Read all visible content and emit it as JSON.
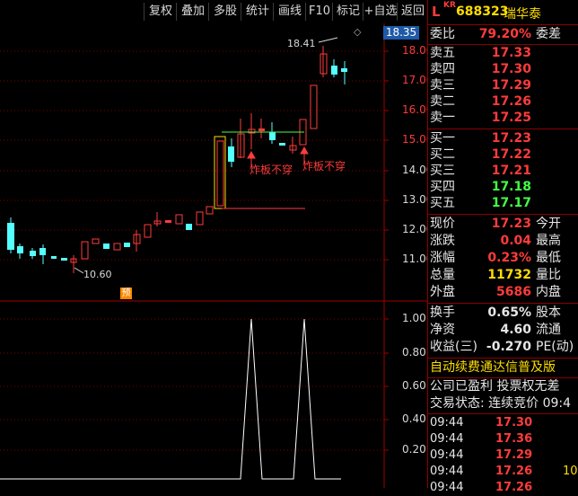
{
  "toolbar": {
    "buttons": [
      "复权",
      "叠加",
      "多股",
      "统计",
      "画线",
      "F10",
      "标记",
      "+自选",
      "返回"
    ]
  },
  "stock": {
    "market_tag": "L",
    "super_tag": "KR",
    "code": "688323",
    "name": "瑞华泰"
  },
  "chart": {
    "current_price_tag": "18.35",
    "price_axis": [
      "18.00",
      "17.00",
      "16.00",
      "15.00",
      "14.00",
      "13.00",
      "12.00",
      "11.00"
    ],
    "high_annotation": "18.41",
    "low_annotation": "10.60",
    "annotation_1": "炸板不穿",
    "annotation_2": "炸板不穿",
    "pre_marker": "预",
    "indicator_axis": [
      "1.00",
      "0.80",
      "0.60",
      "0.40",
      "0.20"
    ]
  },
  "panel": {
    "committee": {
      "label": "委比",
      "value": "79.20%",
      "sub": "委差"
    },
    "sell": [
      {
        "label": "卖五",
        "price": "17.33"
      },
      {
        "label": "卖四",
        "price": "17.30"
      },
      {
        "label": "卖三",
        "price": "17.29"
      },
      {
        "label": "卖二",
        "price": "17.26"
      },
      {
        "label": "卖一",
        "price": "17.25"
      }
    ],
    "buy": [
      {
        "label": "买一",
        "price": "17.23"
      },
      {
        "label": "买二",
        "price": "17.22"
      },
      {
        "label": "买三",
        "price": "17.21"
      },
      {
        "label": "买四",
        "price": "17.18"
      },
      {
        "label": "买五",
        "price": "17.17"
      }
    ],
    "quote": [
      {
        "label": "现价",
        "value": "17.23",
        "sub": "今开"
      },
      {
        "label": "涨跌",
        "value": "0.04",
        "sub": "最高"
      },
      {
        "label": "涨幅",
        "value": "0.23%",
        "sub": "最低"
      },
      {
        "label": "总量",
        "value": "11732",
        "sub": "量比"
      },
      {
        "label": "外盘",
        "value": "5686",
        "sub": "内盘"
      }
    ],
    "stats": [
      {
        "label": "换手",
        "value": "0.65%",
        "sub": "股本"
      },
      {
        "label": "净资",
        "value": "4.60",
        "sub": "流通"
      },
      {
        "label": "收益(三)",
        "value": "-0.270",
        "sub": "PE(动)"
      }
    ],
    "notice": "自动续费通达信普及版",
    "profit_line": "公司已盈利 投票权无差",
    "trade_status": "交易状态: 连续竞价 09:4",
    "ticks": [
      {
        "time": "09:44",
        "price": "17.30"
      },
      {
        "time": "09:44",
        "price": "17.36"
      },
      {
        "time": "09:44",
        "price": "17.29"
      },
      {
        "time": "09:44",
        "price": "17.26",
        "vol": "10"
      },
      {
        "time": "09:44",
        "price": "17.26"
      }
    ]
  }
}
